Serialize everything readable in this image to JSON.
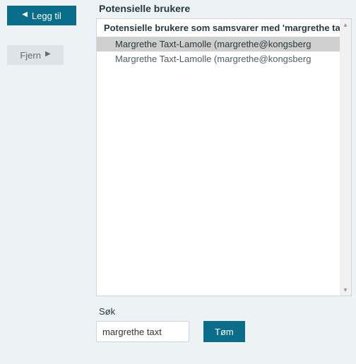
{
  "left": {
    "add_label": "Legg til",
    "remove_label": "Fjern"
  },
  "panel": {
    "heading": "Potensielle brukere",
    "group_header": "Potensielle brukere som samsvarer med 'margrethe taxt'",
    "items": [
      {
        "label": "Margrethe Taxt-Lamolle (margrethe@kongsberg",
        "selected": true
      },
      {
        "label": "Margrethe Taxt-Lamolle (margrethe@kongsberg",
        "selected": false
      }
    ]
  },
  "search": {
    "label": "Søk",
    "value": "margrethe taxt",
    "placeholder": "",
    "clear_label": "Tøm"
  },
  "icons": {
    "triangle_left": "◀",
    "triangle_right": "▶",
    "triangle_up": "▴",
    "triangle_down": "▾"
  }
}
